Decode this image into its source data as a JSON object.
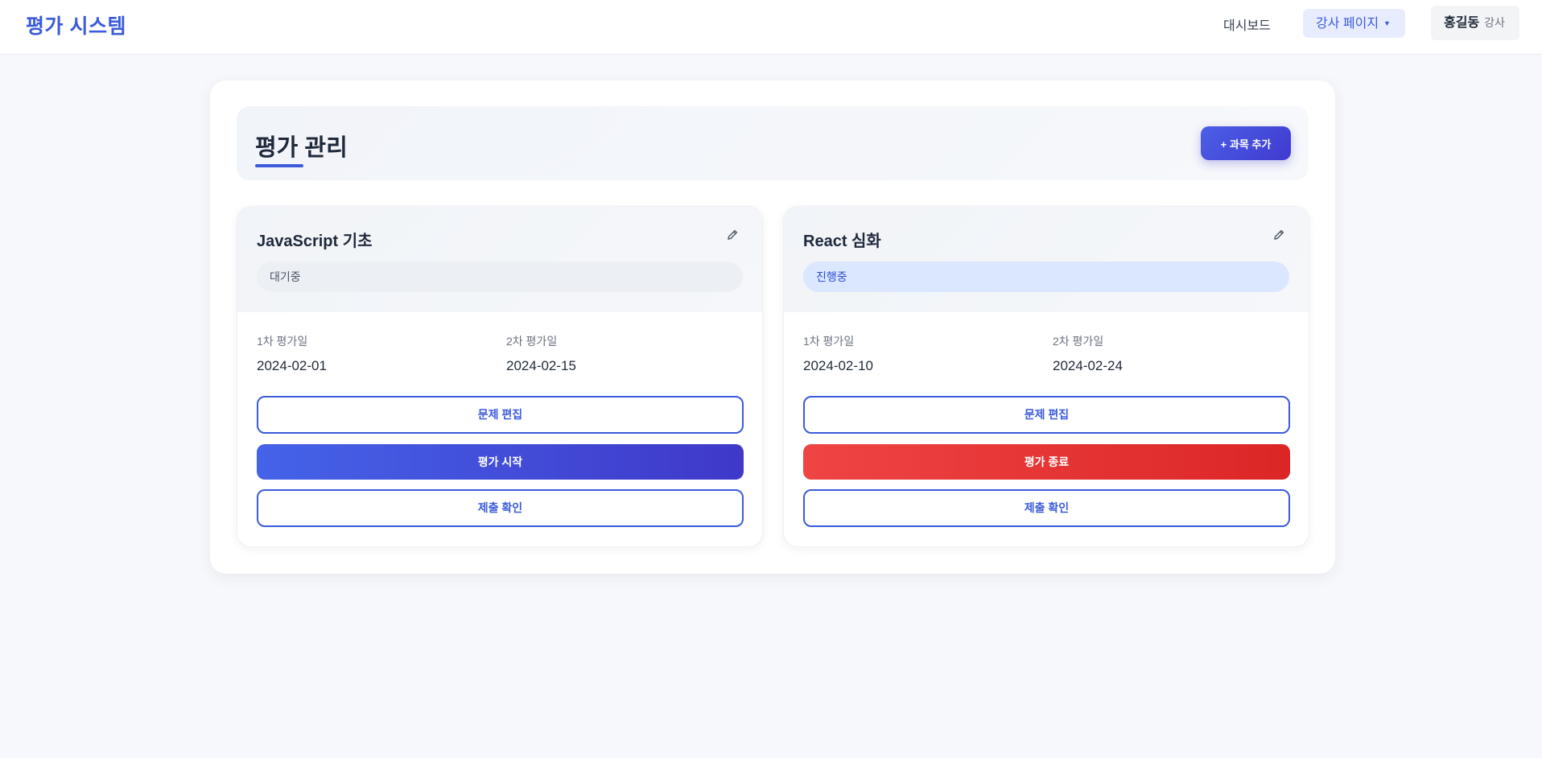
{
  "header": {
    "brand": "평가 시스템",
    "nav_dashboard": "대시보드",
    "nav_instructor": "강사 페이지",
    "user_name": "홍길동",
    "user_role": "강사"
  },
  "page": {
    "title": "평가 관리",
    "add_button": "+ 과목 추가"
  },
  "courses": [
    {
      "title": "JavaScript 기초",
      "status": "대기중",
      "first_label": "1차 평가일",
      "first_date": "2024-02-01",
      "second_label": "2차 평가일",
      "second_date": "2024-02-15",
      "edit_button": "문제 편집",
      "action_button": "평가 시작",
      "submit_button": "제출 확인"
    },
    {
      "title": "React 심화",
      "status": "진행중",
      "first_label": "1차 평가일",
      "first_date": "2024-02-10",
      "second_label": "2차 평가일",
      "second_date": "2024-02-24",
      "edit_button": "문제 편집",
      "action_button": "평가 종료",
      "submit_button": "제출 확인"
    }
  ],
  "colors": {
    "accent": "#3b5bdb",
    "danger": "#dc2626",
    "status_waiting_bg": "#eceff4",
    "status_progress_bg": "#dbe7fe"
  },
  "icons": {
    "edit": "pencil-icon",
    "dropdown": "caret-down-icon"
  }
}
